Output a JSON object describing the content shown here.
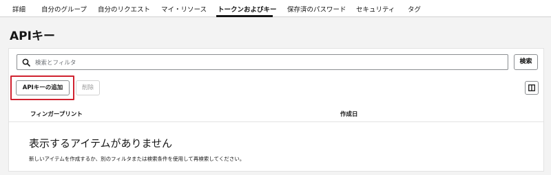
{
  "tabs": {
    "items": [
      {
        "label": "詳細"
      },
      {
        "label": "自分のグループ"
      },
      {
        "label": "自分のリクエスト"
      },
      {
        "label": "マイ・リソース"
      },
      {
        "label": "トークンおよびキー"
      },
      {
        "label": "保存済のパスワード"
      },
      {
        "label": "セキュリティ"
      },
      {
        "label": "タグ"
      }
    ],
    "active": "トークンおよびキー"
  },
  "page": {
    "title": "APIキー"
  },
  "search": {
    "placeholder": "検索とフィルタ",
    "button_label": "検索",
    "icon": "search-icon"
  },
  "toolbar": {
    "add_label": "APIキーの追加",
    "delete_label": "削除",
    "columns_icon": "columns-icon"
  },
  "table": {
    "columns": [
      "フィンガープリント",
      "作成日"
    ],
    "rows": []
  },
  "empty_state": {
    "title": "表示するアイテムがありません",
    "message": "新しいアイテムを作成するか、別のフィルタまたは検索条件を使用して再検索してください。"
  },
  "colors": {
    "highlight": "#d0202e",
    "text": "#151515",
    "background": "#f3f3f3"
  }
}
